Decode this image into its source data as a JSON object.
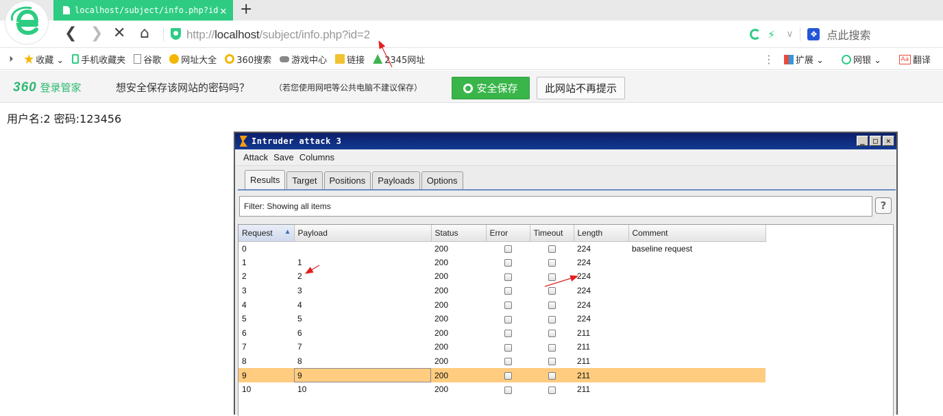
{
  "browser": {
    "tab_title": "localhost/subject/info.php?id",
    "tab_close": "✕",
    "new_tab": "+",
    "url_prefix": "http://",
    "url_host": "localhost",
    "url_path": "/subject/info.php?id=2",
    "search_placeholder": "点此搜索",
    "accent_color": "#2ecc82"
  },
  "bookmarks": {
    "items": [
      {
        "label": "收藏 ⌄",
        "icon": "star-icon"
      },
      {
        "label": "手机收藏夹",
        "icon": "phone-icon"
      },
      {
        "label": "谷歌",
        "icon": "doc-icon"
      },
      {
        "label": "网址大全",
        "icon": "globe-icon"
      },
      {
        "label": "360搜索",
        "icon": "search-360-icon"
      },
      {
        "label": "游戏中心",
        "icon": "gamepad-icon"
      },
      {
        "label": "链接",
        "icon": "folder-icon"
      },
      {
        "label": "2345网址",
        "icon": "2345-icon"
      }
    ],
    "right": [
      {
        "label": "扩展 ⌄",
        "icon": "extension-icon"
      },
      {
        "label": "网银 ⌄",
        "icon": "bank-icon"
      },
      {
        "label": "翻译",
        "icon": "translate-icon"
      }
    ]
  },
  "password_bar": {
    "brand_num": "360",
    "brand_text": "登录管家",
    "question": "想安全保存该网站的密码吗？",
    "hint": "（若您使用网吧等公共电脑不建议保存）",
    "save_label": "安全保存",
    "never_label": "此网站不再提示"
  },
  "page": {
    "text": "用户名:2 密码:123456"
  },
  "burp": {
    "title": "Intruder attack 3",
    "menu": [
      "Attack",
      "Save",
      "Columns"
    ],
    "tabs": [
      "Results",
      "Target",
      "Positions",
      "Payloads",
      "Options"
    ],
    "filter": "Filter:  Showing all items",
    "help": "?",
    "columns": [
      "Request",
      "Payload",
      "Status",
      "Error",
      "Timeout",
      "Length",
      "Comment"
    ],
    "rows": [
      {
        "request": "0",
        "payload": "",
        "status": "200",
        "error": false,
        "timeout": false,
        "length": "224",
        "comment": "baseline request"
      },
      {
        "request": "1",
        "payload": "1",
        "status": "200",
        "error": false,
        "timeout": false,
        "length": "224",
        "comment": ""
      },
      {
        "request": "2",
        "payload": "2",
        "status": "200",
        "error": false,
        "timeout": false,
        "length": "224",
        "comment": ""
      },
      {
        "request": "3",
        "payload": "3",
        "status": "200",
        "error": false,
        "timeout": false,
        "length": "224",
        "comment": ""
      },
      {
        "request": "4",
        "payload": "4",
        "status": "200",
        "error": false,
        "timeout": false,
        "length": "224",
        "comment": ""
      },
      {
        "request": "5",
        "payload": "5",
        "status": "200",
        "error": false,
        "timeout": false,
        "length": "224",
        "comment": ""
      },
      {
        "request": "6",
        "payload": "6",
        "status": "200",
        "error": false,
        "timeout": false,
        "length": "211",
        "comment": ""
      },
      {
        "request": "7",
        "payload": "7",
        "status": "200",
        "error": false,
        "timeout": false,
        "length": "211",
        "comment": ""
      },
      {
        "request": "8",
        "payload": "8",
        "status": "200",
        "error": false,
        "timeout": false,
        "length": "211",
        "comment": ""
      },
      {
        "request": "9",
        "payload": "9",
        "status": "200",
        "error": false,
        "timeout": false,
        "length": "211",
        "comment": "",
        "selected": true
      },
      {
        "request": "10",
        "payload": "10",
        "status": "200",
        "error": false,
        "timeout": false,
        "length": "211",
        "comment": ""
      }
    ],
    "selected_row_color": "#ffcc80"
  }
}
